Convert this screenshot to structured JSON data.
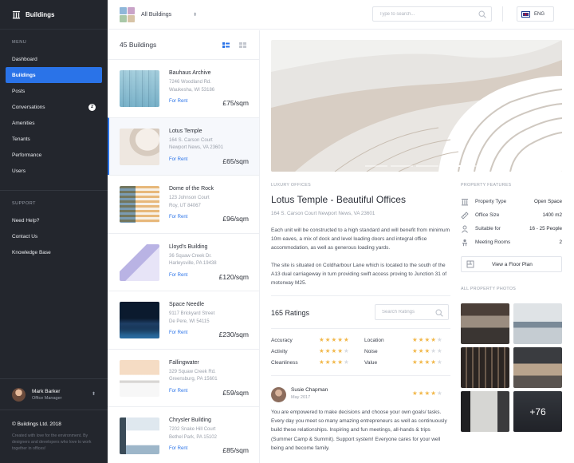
{
  "brand": {
    "name": "Buildings",
    "icon": "building-icon"
  },
  "sidebar": {
    "menu_title": "MENU",
    "items": [
      {
        "label": "Dashboard",
        "active": false
      },
      {
        "label": "Buildings",
        "active": true
      },
      {
        "label": "Posts",
        "active": false
      },
      {
        "label": "Conversations",
        "active": false,
        "badge": "2"
      },
      {
        "label": "Amenities",
        "active": false
      },
      {
        "label": "Tenants",
        "active": false
      },
      {
        "label": "Performance",
        "active": false
      },
      {
        "label": "Users",
        "active": false
      }
    ],
    "support_title": "SUPPORT",
    "support_items": [
      {
        "label": "Need Help?"
      },
      {
        "label": "Contact Us"
      },
      {
        "label": "Knowledge Base"
      }
    ],
    "user": {
      "name": "Mark Barker",
      "role": "Office Manager",
      "toggle_icon": "up-down-caret-icon"
    },
    "copyright": "© Buildings Ltd. 2018",
    "credits": "Created with love for the environment. By designers and developers who love to work together in offices!"
  },
  "topbar": {
    "selector_label": "All Buildings",
    "search_placeholder": "Type to search...",
    "language": "ENG"
  },
  "listing": {
    "count_label": "45 Buildings",
    "cards": [
      {
        "name": "Bauhaus Archive",
        "address1": "7246 Woodland Rd.",
        "address2": "Waukesha, WI 53186",
        "status": "For Rent",
        "price": "£75/sqm",
        "selected": false
      },
      {
        "name": "Lotus Temple",
        "address1": "164 S. Carson Court",
        "address2": "Newport News, VA 23601",
        "status": "For Rent",
        "price": "£65/sqm",
        "selected": true
      },
      {
        "name": "Dome of the Rock",
        "address1": "123 Johnson Court",
        "address2": "Roy, UT 84067",
        "status": "For Rent",
        "price": "£96/sqm",
        "selected": false
      },
      {
        "name": "Lloyd's Building",
        "address1": "36 Squaw Creek Dr.",
        "address2": "Harleysville, PA 19438",
        "status": "For Rent",
        "price": "£120/sqm",
        "selected": false
      },
      {
        "name": "Space Needle",
        "address1": "9117 Brickyard Street",
        "address2": "De Pere, WI 54115",
        "status": "For Rent",
        "price": "£230/sqm",
        "selected": false
      },
      {
        "name": "Fallingwater",
        "address1": "329 Squaw Creek Rd.",
        "address2": "Greensburg, PA 15601",
        "status": "For Rent",
        "price": "£59/sqm",
        "selected": false
      },
      {
        "name": "Chrysler Building",
        "address1": "7202 Snake Hill Court",
        "address2": "Bethel Park, PA 15102",
        "status": "For Rent",
        "price": "£85/sqm",
        "selected": false
      }
    ]
  },
  "detail": {
    "category": "LUXURY OFFICES",
    "title": "Lotus Temple - Beautiful Offices",
    "address": "164 S. Carson Court Newport News, VA 23601",
    "paragraph1": "Each unit will be constructed to a high standard and will benefit from minimum 10m eaves, a mix of dock and level loading doors and integral office accommodation, as well as generous loading yards.",
    "paragraph2": "The site is situated on Coldharbour Lane which is located to the south of the A13 dual carriageway in turn providing swift access proving to Junction 31 of motorway M25.",
    "ratings": {
      "title": "165 Ratings",
      "search_placeholder": "Search Ratings",
      "items": [
        {
          "label": "Accuracy",
          "stars": 5
        },
        {
          "label": "Location",
          "stars": 4
        },
        {
          "label": "Activity",
          "stars": 4
        },
        {
          "label": "Noise",
          "stars": 3
        },
        {
          "label": "Cleanliness",
          "stars": 4
        },
        {
          "label": "Value",
          "stars": 4
        }
      ]
    },
    "review": {
      "name": "Susie Chapman",
      "date": "May 2017",
      "stars": 4,
      "text": "You are empowered to make decisions and choose your own goals/ tasks. Every day you meet so many amazing entrepreneurs as well as continuously build these relationships. Inspiring and fun meetings, all-hands & trips (Summer Camp & Summit). Support system! Everyone cares for your well being and become family."
    }
  },
  "features": {
    "title": "PROPERTY FEATURES",
    "items": [
      {
        "icon": "building-icon",
        "label": "Property Type",
        "value": "Open Space"
      },
      {
        "icon": "ruler-icon",
        "label": "Office Size",
        "value": "1400 m2"
      },
      {
        "icon": "people-icon",
        "label": "Suitable for",
        "value": "16 - 25 People"
      },
      {
        "icon": "meeting-rooms-icon",
        "label": "Meeting Rooms",
        "value": "2"
      }
    ],
    "floor_plan_label": "View a Floor Plan",
    "photos_title": "ALL PROPERTY PHOTOS",
    "more_photos": "+76"
  },
  "colors": {
    "accent": "#2a73e8",
    "sidebar": "#23262d",
    "star": "#f2b84b"
  }
}
